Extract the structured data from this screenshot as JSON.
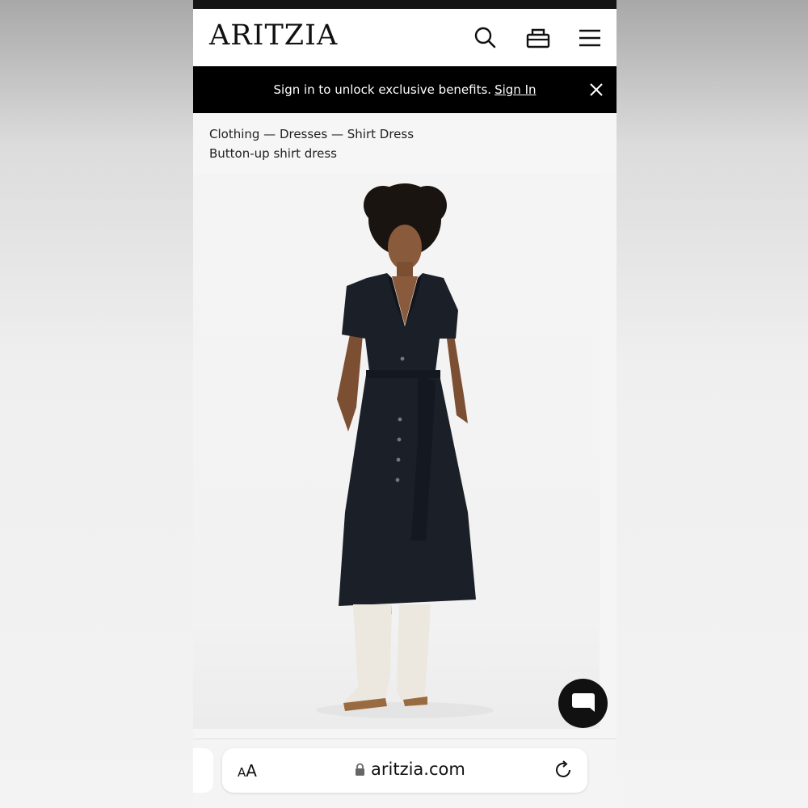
{
  "header": {
    "logo": "ARITZIA",
    "icons": [
      "search-icon",
      "bag-icon",
      "menu-icon"
    ]
  },
  "banner": {
    "message": "Sign in to unlock exclusive benefits.",
    "link_label": "Sign In"
  },
  "breadcrumb": {
    "path": "Clothing — Dresses — Shirt Dress",
    "product_name": "Button-up shirt dress"
  },
  "browser": {
    "text_size_label_small": "A",
    "text_size_label_large": "A",
    "url": "aritzia.com"
  },
  "colors": {
    "banner_bg": "#000000",
    "dress": "#1b1f27",
    "boots": "#ece8df",
    "chat_button": "#111111"
  }
}
